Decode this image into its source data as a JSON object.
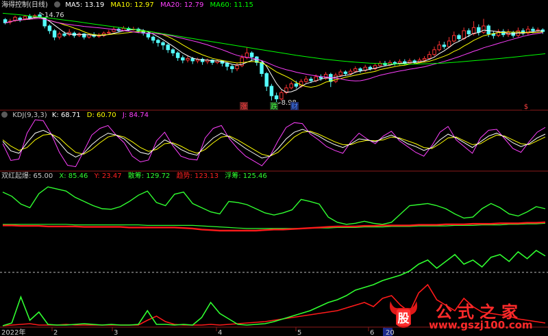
{
  "main_panel": {
    "title": "海得控制(日线)",
    "ma": [
      {
        "label": "MA5: 13.19",
        "color": "#ffffff"
      },
      {
        "label": "MA10: 12.97",
        "color": "#ffff00"
      },
      {
        "label": "MA20: 12.79",
        "color": "#ff40ff"
      },
      {
        "label": "MA60: 11.15",
        "color": "#00ff00"
      }
    ],
    "high_label": "14.76",
    "low_label": "8.98",
    "events": [
      {
        "text": "涨",
        "color": "#ff4040",
        "bg": "#602020"
      },
      {
        "text": "跌",
        "color": "#40ff40",
        "bg": "#204020"
      },
      {
        "text": "财",
        "color": "#4080ff",
        "bg": "#202a60"
      },
      {
        "text": "$",
        "color": "#ff4040",
        "bg": "#000000"
      }
    ]
  },
  "kdj_panel": {
    "title": "KDJ(9,3,3)",
    "k_label": "K: 68.71",
    "d_label": "D: 60.70",
    "j_label": "J: 84.74",
    "k_color": "#ffffff",
    "d_color": "#ffff00",
    "j_color": "#ff40ff"
  },
  "shr_panel": {
    "title": "双红起爆",
    "value": ": 65.00",
    "x_label": "X: 85.46",
    "y_label": "Y: 23.47",
    "sc_label": "散筹: 129.72",
    "qs_label": "趋势: 123.13",
    "fc_label": "浮筹: 125.46",
    "x_color": "#30ff30",
    "y_color": "#ff2020",
    "sc_color": "#30ff30",
    "qs_color": "#ff2020",
    "fc_color": "#30ff30"
  },
  "time_axis": {
    "year_label": "2022年",
    "labels": [
      "2",
      "3",
      "4",
      "5",
      "6",
      "20"
    ]
  },
  "watermark": {
    "line1": "公式之家",
    "line2": "www.gszj100.com",
    "glyph": "股"
  },
  "chart_data": {
    "type": "line",
    "price_range": [
      8.98,
      14.76
    ],
    "candles": [
      [
        14.3,
        14.1,
        14.4,
        14.0
      ],
      [
        14.15,
        14.2,
        14.35,
        14.0
      ],
      [
        14.25,
        14.45,
        14.55,
        14.15
      ],
      [
        14.4,
        14.3,
        14.5,
        14.15
      ],
      [
        14.35,
        14.5,
        14.6,
        14.25
      ],
      [
        14.5,
        14.4,
        14.65,
        14.3
      ],
      [
        14.45,
        14.55,
        14.65,
        14.35
      ],
      [
        14.6,
        14.5,
        14.76,
        14.4
      ],
      [
        14.4,
        13.9,
        14.45,
        13.75
      ],
      [
        13.9,
        13.6,
        14.0,
        13.4
      ],
      [
        13.6,
        13.2,
        13.7,
        13.0
      ],
      [
        13.2,
        13.4,
        13.55,
        13.05
      ],
      [
        13.4,
        13.3,
        13.55,
        13.2
      ],
      [
        13.35,
        13.5,
        13.7,
        13.25
      ],
      [
        13.45,
        13.3,
        13.55,
        13.15
      ],
      [
        13.3,
        13.4,
        13.5,
        13.2
      ],
      [
        13.4,
        13.2,
        13.45,
        13.05
      ],
      [
        13.2,
        13.35,
        13.45,
        13.1
      ],
      [
        13.35,
        13.25,
        13.5,
        13.15
      ],
      [
        13.25,
        13.3,
        13.45,
        13.15
      ],
      [
        13.3,
        13.45,
        13.55,
        13.2
      ],
      [
        13.45,
        13.5,
        13.65,
        13.4
      ],
      [
        13.55,
        13.7,
        13.85,
        13.5
      ],
      [
        13.7,
        13.6,
        13.8,
        13.5
      ],
      [
        13.6,
        13.75,
        13.9,
        13.55
      ],
      [
        13.75,
        13.65,
        13.85,
        13.55
      ],
      [
        13.65,
        13.7,
        13.85,
        13.6
      ],
      [
        13.7,
        13.6,
        13.8,
        13.45
      ],
      [
        13.6,
        13.45,
        13.7,
        13.3
      ],
      [
        13.45,
        13.2,
        13.55,
        13.05
      ],
      [
        13.2,
        13.0,
        13.3,
        12.8
      ],
      [
        13.0,
        12.85,
        13.1,
        12.6
      ],
      [
        12.85,
        12.7,
        12.95,
        12.4
      ],
      [
        12.7,
        12.4,
        12.8,
        12.2
      ],
      [
        12.4,
        12.2,
        12.5,
        12.0
      ],
      [
        12.2,
        11.9,
        12.3,
        11.7
      ],
      [
        11.9,
        11.75,
        12.05,
        11.55
      ],
      [
        11.75,
        11.85,
        12.0,
        11.6
      ],
      [
        11.85,
        11.7,
        11.95,
        11.5
      ],
      [
        11.7,
        11.8,
        11.9,
        11.55
      ],
      [
        11.8,
        11.65,
        11.9,
        11.45
      ],
      [
        11.65,
        11.75,
        11.85,
        11.5
      ],
      [
        11.75,
        11.6,
        11.8,
        11.45
      ],
      [
        11.6,
        11.7,
        11.8,
        11.5
      ],
      [
        11.7,
        11.55,
        11.75,
        11.35
      ],
      [
        11.55,
        11.35,
        11.6,
        11.1
      ],
      [
        11.35,
        11.2,
        11.45,
        10.95
      ],
      [
        11.2,
        11.4,
        11.55,
        11.05
      ],
      [
        11.4,
        11.9,
        12.1,
        11.3
      ],
      [
        11.9,
        12.2,
        12.55,
        11.8
      ],
      [
        12.2,
        11.95,
        12.3,
        11.7
      ],
      [
        11.95,
        11.6,
        12.0,
        11.4
      ],
      [
        11.6,
        10.9,
        11.7,
        10.7
      ],
      [
        10.9,
        10.1,
        11.0,
        9.8
      ],
      [
        10.1,
        9.5,
        10.25,
        9.2
      ],
      [
        9.5,
        9.3,
        9.7,
        8.98
      ],
      [
        9.3,
        9.7,
        9.85,
        9.2
      ],
      [
        9.7,
        10.0,
        10.2,
        9.6
      ],
      [
        10.0,
        10.25,
        10.4,
        9.9
      ],
      [
        10.25,
        10.1,
        10.45,
        9.95
      ],
      [
        10.1,
        10.4,
        10.55,
        10.0
      ],
      [
        10.4,
        10.55,
        10.75,
        10.3
      ],
      [
        10.55,
        10.45,
        10.7,
        10.3
      ],
      [
        10.45,
        10.7,
        10.85,
        10.35
      ],
      [
        10.7,
        10.6,
        10.85,
        10.45
      ],
      [
        10.6,
        10.85,
        11.0,
        10.5
      ],
      [
        10.85,
        10.4,
        10.95,
        10.05
      ],
      [
        10.4,
        10.8,
        10.95,
        10.3
      ],
      [
        10.8,
        11.0,
        11.15,
        10.7
      ],
      [
        11.0,
        10.9,
        11.1,
        10.75
      ],
      [
        10.9,
        11.05,
        11.2,
        10.8
      ],
      [
        11.05,
        11.2,
        11.35,
        10.95
      ],
      [
        11.2,
        11.1,
        11.3,
        10.95
      ],
      [
        11.1,
        11.3,
        11.45,
        11.0
      ],
      [
        11.3,
        11.2,
        11.4,
        11.1
      ],
      [
        11.2,
        11.4,
        11.55,
        11.1
      ],
      [
        11.4,
        11.55,
        11.7,
        11.3
      ],
      [
        11.55,
        11.45,
        11.7,
        11.35
      ],
      [
        11.45,
        11.6,
        11.75,
        11.35
      ],
      [
        11.6,
        11.5,
        11.7,
        11.4
      ],
      [
        11.5,
        11.65,
        11.8,
        11.4
      ],
      [
        11.65,
        11.55,
        11.8,
        11.45
      ],
      [
        11.55,
        11.7,
        11.85,
        11.5
      ],
      [
        11.7,
        11.6,
        11.8,
        11.5
      ],
      [
        11.6,
        11.75,
        11.9,
        11.55
      ],
      [
        11.75,
        11.85,
        12.0,
        11.65
      ],
      [
        11.85,
        12.1,
        12.3,
        11.8
      ],
      [
        12.1,
        12.4,
        12.6,
        12.0
      ],
      [
        12.4,
        12.7,
        12.95,
        12.3
      ],
      [
        12.7,
        12.6,
        12.9,
        12.45
      ],
      [
        12.6,
        12.95,
        13.2,
        12.5
      ],
      [
        12.95,
        13.3,
        13.55,
        12.85
      ],
      [
        13.3,
        13.1,
        13.4,
        12.9
      ],
      [
        13.1,
        13.6,
        13.8,
        13.0
      ],
      [
        13.6,
        13.4,
        13.75,
        13.2
      ],
      [
        13.4,
        13.8,
        14.2,
        13.3
      ],
      [
        13.8,
        13.5,
        14.0,
        13.3
      ],
      [
        13.5,
        13.9,
        14.35,
        13.4
      ],
      [
        13.9,
        13.4,
        14.0,
        13.2
      ],
      [
        13.4,
        13.3,
        13.55,
        13.1
      ],
      [
        13.3,
        13.55,
        13.7,
        13.2
      ],
      [
        13.55,
        13.35,
        13.7,
        13.2
      ],
      [
        13.35,
        13.5,
        13.7,
        13.2
      ],
      [
        13.5,
        13.3,
        13.6,
        13.15
      ],
      [
        13.3,
        13.6,
        13.8,
        13.2
      ],
      [
        13.6,
        13.45,
        13.75,
        13.3
      ],
      [
        13.45,
        13.7,
        13.9,
        13.35
      ],
      [
        13.7,
        13.6,
        13.85,
        13.45
      ],
      [
        13.6,
        13.65,
        13.8,
        13.5
      ],
      [
        13.65,
        13.55,
        13.75,
        13.4
      ]
    ],
    "ma60": [
      14.7,
      14.62,
      14.52,
      14.42,
      14.3,
      14.18,
      14.05,
      13.92,
      13.8,
      13.68,
      13.55,
      13.4,
      13.25,
      13.1,
      12.95,
      12.8,
      12.65,
      12.5,
      12.35,
      12.2,
      12.05,
      11.92,
      11.8,
      11.7,
      11.62,
      11.56,
      11.52,
      11.5,
      11.5,
      11.52,
      11.56,
      11.62,
      11.7,
      11.78,
      11.86,
      11.95,
      12.05,
      12.15
    ],
    "kdj": {
      "k": [
        55,
        35,
        30,
        52,
        72,
        78,
        70,
        52,
        32,
        22,
        30,
        48,
        62,
        72,
        68,
        60,
        44,
        32,
        28,
        44,
        58,
        50,
        38,
        30,
        26,
        46,
        62,
        72,
        64,
        52,
        40,
        30,
        20,
        24,
        40,
        60,
        74,
        80,
        74,
        66,
        56,
        48,
        42,
        50,
        60,
        58,
        54,
        62,
        68,
        60,
        50,
        44,
        36,
        42,
        58,
        70,
        62,
        52,
        42,
        54,
        66,
        72,
        64,
        52,
        44,
        50,
        62,
        70
      ],
      "d": [
        58,
        45,
        36,
        42,
        58,
        68,
        70,
        62,
        46,
        32,
        28,
        38,
        52,
        64,
        68,
        64,
        54,
        42,
        34,
        38,
        50,
        52,
        45,
        36,
        30,
        38,
        52,
        64,
        66,
        58,
        48,
        38,
        28,
        24,
        32,
        48,
        64,
        74,
        76,
        70,
        62,
        54,
        48,
        48,
        54,
        57,
        56,
        58,
        64,
        62,
        56,
        50,
        42,
        40,
        50,
        62,
        64,
        56,
        48,
        50,
        60,
        68,
        66,
        58,
        50,
        48,
        56,
        64
      ],
      "j": [
        50,
        15,
        18,
        72,
        100,
        98,
        70,
        32,
        5,
        2,
        34,
        68,
        82,
        88,
        68,
        52,
        24,
        12,
        16,
        56,
        74,
        46,
        24,
        18,
        16,
        62,
        82,
        88,
        60,
        40,
        24,
        14,
        4,
        24,
        56,
        84,
        94,
        92,
        70,
        58,
        44,
        36,
        30,
        54,
        72,
        60,
        50,
        66,
        76,
        56,
        44,
        32,
        24,
        46,
        74,
        86,
        58,
        44,
        30,
        62,
        78,
        80,
        60,
        40,
        32,
        54,
        74,
        84
      ]
    },
    "shr": {
      "x": [
        78,
        70,
        55,
        48,
        75,
        88,
        84,
        80,
        68,
        60,
        52,
        46,
        45,
        50,
        60,
        72,
        80,
        58,
        52,
        74,
        78,
        56,
        48,
        40,
        36,
        60,
        58,
        54,
        46,
        38,
        34,
        38,
        44,
        64,
        60,
        55,
        30,
        20,
        16,
        18,
        22,
        18,
        16,
        20,
        36,
        52,
        54,
        56,
        52,
        46,
        36,
        28,
        30,
        46,
        56,
        48,
        36,
        32,
        40,
        50,
        46
      ],
      "y": [
        14,
        14,
        13,
        13,
        13,
        12,
        12,
        12,
        12,
        11,
        11,
        11,
        11,
        11,
        10,
        10,
        10,
        10,
        10,
        10,
        9,
        8,
        6,
        5,
        4,
        4,
        4,
        4,
        4,
        5,
        6,
        6,
        7,
        8,
        9,
        10,
        11,
        12,
        12,
        12,
        13,
        13,
        14,
        14,
        14,
        14,
        15,
        15,
        15,
        16,
        16,
        16,
        17,
        17,
        17,
        18,
        18,
        18,
        19,
        19,
        20
      ],
      "fc": [
        16,
        16,
        16,
        16,
        16,
        16,
        16,
        16,
        15,
        15,
        15,
        15,
        15,
        15,
        15,
        15,
        14,
        14,
        14,
        14,
        14,
        14,
        13,
        12,
        11,
        10,
        9,
        8,
        8,
        8,
        8,
        8,
        8,
        8,
        9,
        9,
        9,
        10,
        10,
        10,
        11,
        11,
        11,
        12,
        12,
        12,
        13,
        13,
        13,
        13,
        14,
        14,
        14,
        15,
        15,
        15,
        16,
        16,
        17,
        17,
        18
      ]
    },
    "bottom": {
      "green": [
        0,
        4,
        42,
        8,
        20,
        2,
        1,
        1,
        2,
        3,
        2,
        1,
        2,
        1,
        1,
        2,
        22,
        2,
        2,
        1,
        2,
        1,
        12,
        34,
        18,
        10,
        2,
        1,
        2,
        3,
        6,
        10,
        14,
        18,
        22,
        28,
        34,
        38,
        44,
        52,
        56,
        60,
        66,
        70,
        74,
        80,
        90,
        96,
        84,
        94,
        104,
        90,
        96,
        86,
        100,
        104,
        94,
        108,
        98,
        110,
        102
      ],
      "red": [
        0,
        1,
        2,
        3,
        1,
        1,
        1,
        2,
        1,
        1,
        1,
        1,
        1,
        1,
        1,
        1,
        8,
        14,
        6,
        2,
        1,
        1,
        1,
        2,
        1,
        2,
        3,
        4,
        5,
        6,
        8,
        10,
        12,
        14,
        16,
        18,
        20,
        22,
        26,
        30,
        34,
        28,
        40,
        44,
        30,
        20,
        48,
        60,
        38,
        30,
        22,
        40,
        28,
        20,
        18,
        16,
        14,
        10,
        8,
        6,
        4
      ]
    }
  }
}
